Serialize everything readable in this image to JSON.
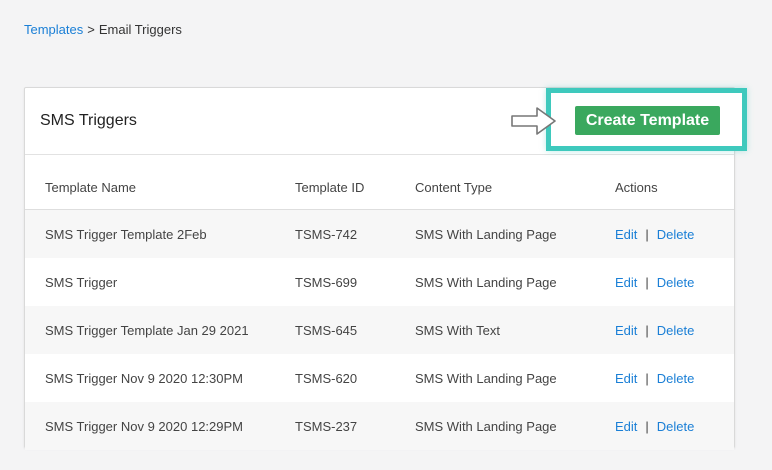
{
  "breadcrumb": {
    "parent": "Templates",
    "separator": ">",
    "current": "Email Triggers"
  },
  "card": {
    "title": "SMS Triggers",
    "create_button": "Create Template"
  },
  "table": {
    "headers": [
      "Template Name",
      "Template ID",
      "Content Type",
      "Actions"
    ],
    "edit_label": "Edit",
    "action_separator": "|",
    "delete_label": "Delete",
    "rows": [
      {
        "name": "SMS Trigger Template 2Feb",
        "id": "TSMS-742",
        "type": "SMS With Landing Page"
      },
      {
        "name": "SMS Trigger",
        "id": "TSMS-699",
        "type": "SMS With Landing Page"
      },
      {
        "name": "SMS Trigger Template Jan 29 2021",
        "id": "TSMS-645",
        "type": "SMS With Text"
      },
      {
        "name": "SMS Trigger Nov 9 2020 12:30PM",
        "id": "TSMS-620",
        "type": "SMS With Landing Page"
      },
      {
        "name": "SMS Trigger Nov 9 2020 12:29PM",
        "id": "TSMS-237",
        "type": "SMS With Landing Page"
      }
    ]
  },
  "colors": {
    "link": "#1a7fd6",
    "button": "#3aa85e",
    "highlight": "#3ec9bd",
    "row_stripe": "#f7f7f7"
  },
  "icons": {
    "pointer": "arrow-right-icon"
  }
}
